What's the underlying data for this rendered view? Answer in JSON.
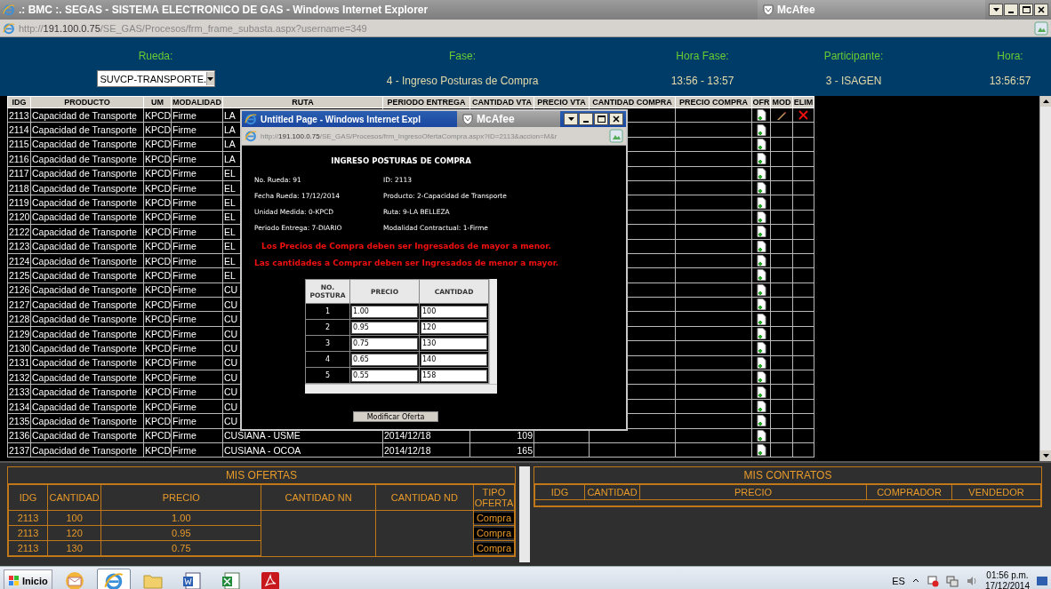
{
  "window": {
    "title": ".: BMC :. SEGAS - SISTEMA ELECTRONICO DE GAS - Windows Internet Explorer",
    "toolbar_brand": "McAfee",
    "url_prefix": "http://",
    "url_host": "191.100.0.75",
    "url_path": "/SE_GAS/Procesos/frm_frame_subasta.aspx?username=349"
  },
  "header": {
    "rueda_label": "Rueda:",
    "rueda_value": "SUVCP-TRANSPORTE.",
    "fase_label": "Fase:",
    "fase_value": "4 - Ingreso Posturas de Compra",
    "hora_fase_label": "Hora Fase:",
    "hora_fase_value": "13:56 - 13:57",
    "participante_label": "Participante:",
    "participante_value": "3 - ISAGEN",
    "hora_label": "Hora:",
    "hora_value": "13:56:57"
  },
  "table": {
    "columns": [
      "IDG",
      "PRODUCTO",
      "UM",
      "MODALIDAD",
      "RUTA",
      "PERIODO ENTREGA",
      "CANTIDAD VTA",
      "PRECIO VTA",
      "CANTIDAD COMPRA",
      "PRECIO COMPRA",
      "OFR",
      "MOD",
      "ELIM"
    ],
    "rows": [
      {
        "idg": "2113",
        "producto": "Capacidad de Transporte",
        "um": "KPCD",
        "modalidad": "Firme",
        "ruta": "LA",
        "editable": true
      },
      {
        "idg": "2114",
        "producto": "Capacidad de Transporte",
        "um": "KPCD",
        "modalidad": "Firme",
        "ruta": "LA",
        "editable": false
      },
      {
        "idg": "2115",
        "producto": "Capacidad de Transporte",
        "um": "KPCD",
        "modalidad": "Firme",
        "ruta": "LA",
        "editable": false
      },
      {
        "idg": "2116",
        "producto": "Capacidad de Transporte",
        "um": "KPCD",
        "modalidad": "Firme",
        "ruta": "LA",
        "editable": false
      },
      {
        "idg": "2117",
        "producto": "Capacidad de Transporte",
        "um": "KPCD",
        "modalidad": "Firme",
        "ruta": "EL",
        "editable": false
      },
      {
        "idg": "2118",
        "producto": "Capacidad de Transporte",
        "um": "KPCD",
        "modalidad": "Firme",
        "ruta": "EL",
        "editable": false
      },
      {
        "idg": "2119",
        "producto": "Capacidad de Transporte",
        "um": "KPCD",
        "modalidad": "Firme",
        "ruta": "EL",
        "editable": false
      },
      {
        "idg": "2120",
        "producto": "Capacidad de Transporte",
        "um": "KPCD",
        "modalidad": "Firme",
        "ruta": "EL",
        "editable": false
      },
      {
        "idg": "2122",
        "producto": "Capacidad de Transporte",
        "um": "KPCD",
        "modalidad": "Firme",
        "ruta": "EL",
        "editable": false
      },
      {
        "idg": "2123",
        "producto": "Capacidad de Transporte",
        "um": "KPCD",
        "modalidad": "Firme",
        "ruta": "EL",
        "editable": false
      },
      {
        "idg": "2124",
        "producto": "Capacidad de Transporte",
        "um": "KPCD",
        "modalidad": "Firme",
        "ruta": "EL",
        "editable": false
      },
      {
        "idg": "2125",
        "producto": "Capacidad de Transporte",
        "um": "KPCD",
        "modalidad": "Firme",
        "ruta": "EL",
        "editable": false
      },
      {
        "idg": "2126",
        "producto": "Capacidad de Transporte",
        "um": "KPCD",
        "modalidad": "Firme",
        "ruta": "CU",
        "editable": false
      },
      {
        "idg": "2127",
        "producto": "Capacidad de Transporte",
        "um": "KPCD",
        "modalidad": "Firme",
        "ruta": "CU",
        "editable": false
      },
      {
        "idg": "2128",
        "producto": "Capacidad de Transporte",
        "um": "KPCD",
        "modalidad": "Firme",
        "ruta": "CU",
        "editable": false
      },
      {
        "idg": "2129",
        "producto": "Capacidad de Transporte",
        "um": "KPCD",
        "modalidad": "Firme",
        "ruta": "CU",
        "editable": false
      },
      {
        "idg": "2130",
        "producto": "Capacidad de Transporte",
        "um": "KPCD",
        "modalidad": "Firme",
        "ruta": "CU",
        "editable": false
      },
      {
        "idg": "2131",
        "producto": "Capacidad de Transporte",
        "um": "KPCD",
        "modalidad": "Firme",
        "ruta": "CU",
        "editable": false
      },
      {
        "idg": "2132",
        "producto": "Capacidad de Transporte",
        "um": "KPCD",
        "modalidad": "Firme",
        "ruta": "CU",
        "editable": false
      },
      {
        "idg": "2133",
        "producto": "Capacidad de Transporte",
        "um": "KPCD",
        "modalidad": "Firme",
        "ruta": "CU",
        "editable": false
      },
      {
        "idg": "2134",
        "producto": "Capacidad de Transporte",
        "um": "KPCD",
        "modalidad": "Firme",
        "ruta": "CU",
        "editable": false
      },
      {
        "idg": "2135",
        "producto": "Capacidad de Transporte",
        "um": "KPCD",
        "modalidad": "Firme",
        "ruta": "CU",
        "editable": false
      },
      {
        "idg": "2136",
        "producto": "Capacidad de Transporte",
        "um": "KPCD",
        "modalidad": "Firme",
        "ruta": "CUSIANA - USME",
        "periodo_entrega": "2014/12/18",
        "cantidad_vta": "109",
        "editable": false
      },
      {
        "idg": "2137",
        "producto": "Capacidad de Transporte",
        "um": "KPCD",
        "modalidad": "Firme",
        "ruta": "CUSIANA - OCOA",
        "periodo_entrega": "2014/12/18",
        "cantidad_vta": "165",
        "editable": false
      }
    ]
  },
  "popup": {
    "title": "Untitled Page - Windows Internet Expl",
    "toolbar_brand": "McAfee",
    "url_prefix": "http://",
    "url_host": "191.100.0.75",
    "url_path": "/SE_GAS/Procesos/frm_IngresoOfertaCompra.aspx?ID=2113&accion=M&r",
    "heading": "INGRESO POSTURAS DE COMPRA",
    "info": [
      "No. Rueda: 91",
      "ID: 2113",
      "Fecha Rueda: 17/12/2014",
      "Producto: 2-Capacidad de Transporte",
      "Unidad Medida: 0-KPCD",
      "Ruta: 9-LA BELLEZA",
      "Periodo Entrega: 7-DIARIO",
      "Modalidad Contractual: 1-Firme"
    ],
    "warnings": [
      "Los Precios de Compra deben ser Ingresados de mayor a menor.",
      "Las cantidades a Comprar deben ser Ingresados de menor a mayor."
    ],
    "columns": [
      "NO. POSTURA",
      "PRECIO",
      "CANTIDAD"
    ],
    "rows": [
      {
        "no": "1",
        "precio": "1.00",
        "cantidad": "100"
      },
      {
        "no": "2",
        "precio": "0.95",
        "cantidad": "120"
      },
      {
        "no": "3",
        "precio": "0.75",
        "cantidad": "130"
      },
      {
        "no": "4",
        "precio": "0.65",
        "cantidad": "140"
      },
      {
        "no": "5",
        "precio": "0.55",
        "cantidad": "158"
      }
    ],
    "button": "Modificar Oferta"
  },
  "mis_ofertas": {
    "title": "MIS OFERTAS",
    "columns": [
      "IDG",
      "CANTIDAD",
      "PRECIO",
      "CANTIDAD NN",
      "CANTIDAD ND",
      "TIPO OFERTA"
    ],
    "rows": [
      {
        "idg": "2113",
        "cantidad": "100",
        "precio": "1.00",
        "tipo": "Compra"
      },
      {
        "idg": "2113",
        "cantidad": "120",
        "precio": "0.95",
        "tipo": "Compra"
      },
      {
        "idg": "2113",
        "cantidad": "130",
        "precio": "0.75",
        "tipo": "Compra"
      }
    ]
  },
  "mis_contratos": {
    "title": "MIS CONTRATOS",
    "columns": [
      "IDG",
      "CANTIDAD",
      "PRECIO",
      "COMPRADOR",
      "VENDEDOR"
    ]
  },
  "taskbar": {
    "start": "Inicio",
    "apps": [
      {
        "kind": "mail",
        "selected": false
      },
      {
        "kind": "browser",
        "selected": true
      },
      {
        "kind": "folder",
        "selected": false
      },
      {
        "kind": "word",
        "selected": false
      },
      {
        "kind": "excel",
        "selected": false
      },
      {
        "kind": "pdf",
        "selected": false
      }
    ],
    "language": "ES",
    "time": "01:56 p.m.",
    "date": "17/12/2014"
  }
}
